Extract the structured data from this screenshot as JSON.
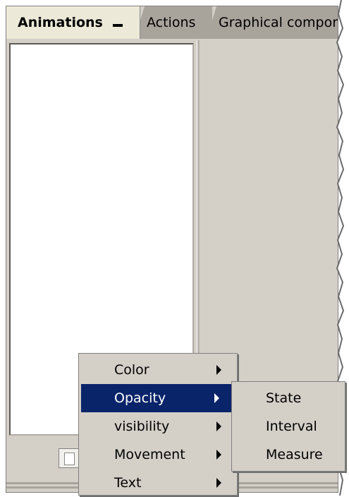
{
  "tabs": [
    {
      "label": "Animations"
    },
    {
      "label": "Actions"
    },
    {
      "label": "Graphical compone"
    }
  ],
  "context_menu": {
    "items": [
      {
        "label": "Color",
        "has_submenu": true
      },
      {
        "label": "Opacity",
        "has_submenu": true,
        "highlighted": true
      },
      {
        "label": "visibility",
        "has_submenu": true
      },
      {
        "label": "Movement",
        "has_submenu": true
      },
      {
        "label": "Text",
        "has_submenu": true
      }
    ],
    "highlight_color": "#0a246a"
  },
  "submenu": {
    "items": [
      {
        "label": "State"
      },
      {
        "label": "Interval"
      },
      {
        "label": "Measure"
      }
    ]
  },
  "colors": {
    "panel": "#d4d0c8",
    "selected": "#0a246a"
  }
}
